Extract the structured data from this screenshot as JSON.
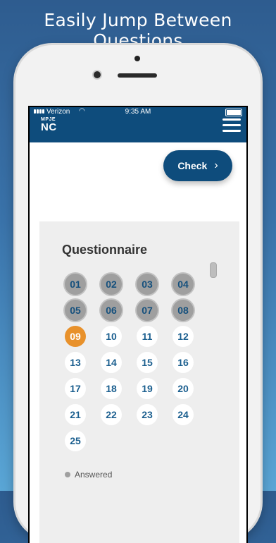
{
  "promo": {
    "headline": "Easily Jump Between Questions"
  },
  "status_bar": {
    "carrier": "Verizon",
    "time": "9:35 AM"
  },
  "header": {
    "logo_top": "MPJE",
    "logo_bottom": "NC",
    "menu_icon": "hamburger-menu-icon"
  },
  "check_button": {
    "label": "Check",
    "icon": "chevron-right-icon"
  },
  "questionnaire": {
    "title": "Questionnaire",
    "questions": [
      {
        "label": "01",
        "state": "answered"
      },
      {
        "label": "02",
        "state": "answered"
      },
      {
        "label": "03",
        "state": "answered"
      },
      {
        "label": "04",
        "state": "answered"
      },
      {
        "label": "05",
        "state": "answered"
      },
      {
        "label": "06",
        "state": "answered"
      },
      {
        "label": "07",
        "state": "answered"
      },
      {
        "label": "08",
        "state": "answered"
      },
      {
        "label": "09",
        "state": "current"
      },
      {
        "label": "10",
        "state": "unanswered"
      },
      {
        "label": "11",
        "state": "unanswered"
      },
      {
        "label": "12",
        "state": "unanswered"
      },
      {
        "label": "13",
        "state": "unanswered"
      },
      {
        "label": "14",
        "state": "unanswered"
      },
      {
        "label": "15",
        "state": "unanswered"
      },
      {
        "label": "16",
        "state": "unanswered"
      },
      {
        "label": "17",
        "state": "unanswered"
      },
      {
        "label": "18",
        "state": "unanswered"
      },
      {
        "label": "19",
        "state": "unanswered"
      },
      {
        "label": "20",
        "state": "unanswered"
      },
      {
        "label": "21",
        "state": "unanswered"
      },
      {
        "label": "22",
        "state": "unanswered"
      },
      {
        "label": "23",
        "state": "unanswered"
      },
      {
        "label": "24",
        "state": "unanswered"
      },
      {
        "label": "25",
        "state": "unanswered"
      }
    ],
    "legend": {
      "answered": "Answered"
    }
  },
  "colors": {
    "header": "#0e4c7c",
    "answered": "#9f9f9f",
    "current": "#e8912b",
    "number_text": "#1b5f8f"
  }
}
